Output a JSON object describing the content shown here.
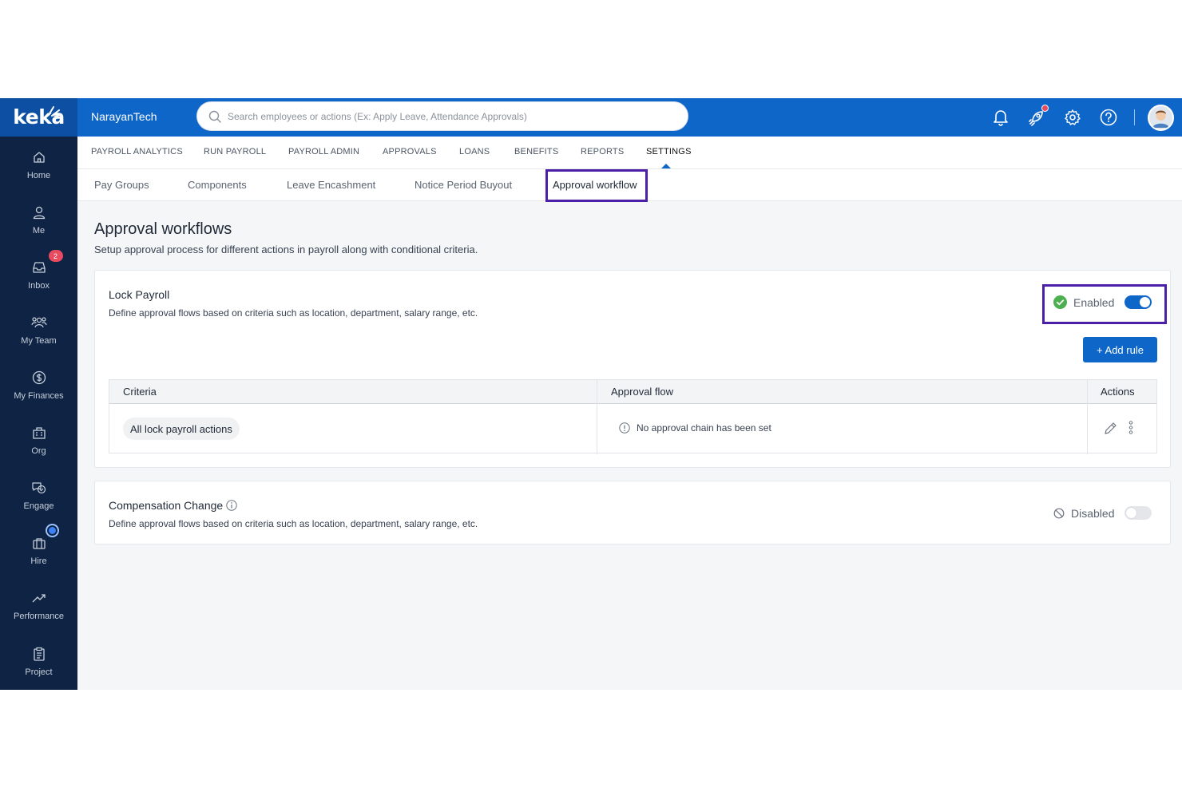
{
  "brand": {
    "logo": "keka",
    "company": "NarayanTech"
  },
  "search": {
    "placeholder": "Search employees or actions (Ex: Apply Leave, Attendance Approvals)"
  },
  "top_icons": [
    "bell-icon",
    "rocket-icon",
    "gear-icon",
    "help-icon"
  ],
  "sidebar": {
    "items": [
      {
        "label": "Home",
        "icon": "home-icon"
      },
      {
        "label": "Me",
        "icon": "user-icon"
      },
      {
        "label": "Inbox",
        "icon": "inbox-icon",
        "badge": "2"
      },
      {
        "label": "My Team",
        "icon": "team-icon"
      },
      {
        "label": "My Finances",
        "icon": "dollar-icon"
      },
      {
        "label": "Org",
        "icon": "org-icon"
      },
      {
        "label": "Engage",
        "icon": "engage-icon"
      },
      {
        "label": "Hire",
        "icon": "briefcase-icon"
      },
      {
        "label": "Performance",
        "icon": "trend-icon"
      },
      {
        "label": "Project",
        "icon": "clipboard-icon"
      }
    ]
  },
  "menu": {
    "items": [
      "PAYROLL ANALYTICS",
      "RUN PAYROLL",
      "PAYROLL ADMIN",
      "APPROVALS",
      "LOANS",
      "BENEFITS",
      "REPORTS",
      "SETTINGS"
    ],
    "active": "SETTINGS"
  },
  "subtabs": {
    "items": [
      "Pay Groups",
      "Components",
      "Leave Encashment",
      "Notice Period Buyout",
      "Approval workflow"
    ],
    "active": "Approval workflow"
  },
  "page": {
    "title": "Approval workflows",
    "subtitle": "Setup approval process for different actions in payroll along with conditional criteria."
  },
  "lock_payroll": {
    "title": "Lock Payroll",
    "description": "Define approval flows based on criteria such as location, department, salary range, etc.",
    "status": "Enabled",
    "enabled": true,
    "add_rule_label": "+ Add rule",
    "table": {
      "headers": [
        "Criteria",
        "Approval flow",
        "Actions"
      ],
      "rows": [
        {
          "criteria": "All lock payroll actions",
          "approval_flow": "No approval chain has been set"
        }
      ]
    }
  },
  "compensation_change": {
    "title": "Compensation Change",
    "description": "Define approval flows based on criteria such as location, department, salary range, etc.",
    "status": "Disabled",
    "enabled": false
  },
  "colors": {
    "primary": "#0f66c9",
    "sidebar": "#0f2444",
    "highlight": "#4c1fa8",
    "success": "#4caf50"
  }
}
